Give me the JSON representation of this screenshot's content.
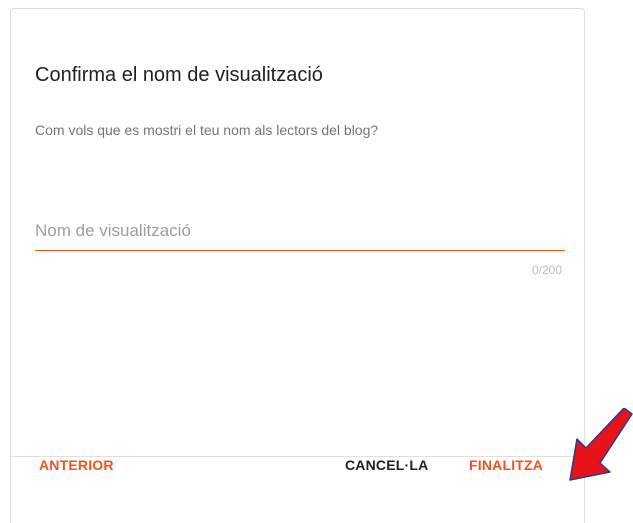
{
  "dialog": {
    "title": "Confirma el nom de visualització",
    "subtitle": "Com vols que es mostri el teu nom als lectors del blog?",
    "display_name": {
      "value": "",
      "placeholder": "Nom de visualització",
      "counter": "0/200"
    },
    "actions": {
      "previous_label": "ANTERIOR",
      "cancel_label": "CANCEL·LA",
      "finish_label": "FINALITZA"
    }
  },
  "annotation": {
    "arrow_icon": "red-arrow-icon",
    "arrow_color": "#e8121b"
  },
  "colors": {
    "accent": "#f4511e",
    "text_primary": "#212121",
    "text_secondary": "#757575"
  }
}
